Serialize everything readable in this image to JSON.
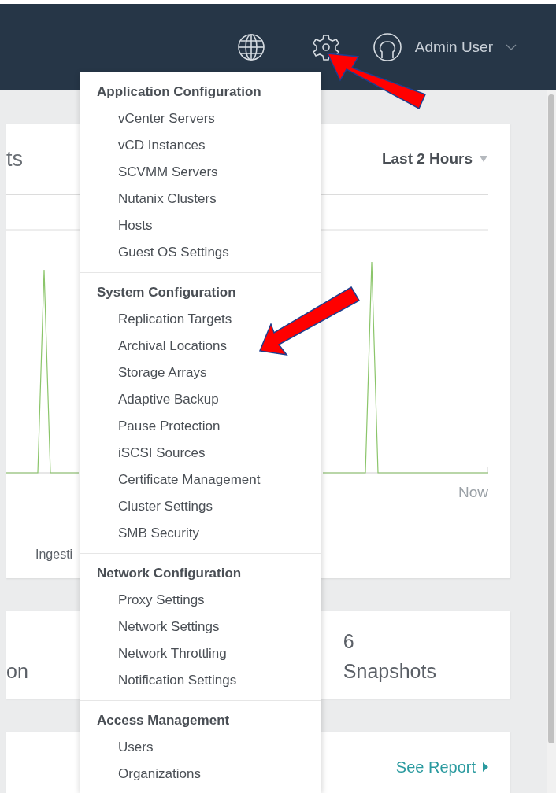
{
  "topbar": {
    "user": "Admin User"
  },
  "settings_menu": {
    "sections": [
      {
        "title": "Application Configuration",
        "items": [
          "vCenter Servers",
          "vCD Instances",
          "SCVMM Servers",
          "Nutanix Clusters",
          "Hosts",
          "Guest OS Settings"
        ]
      },
      {
        "title": "System Configuration",
        "items": [
          "Replication Targets",
          "Archival Locations",
          "Storage Arrays",
          "Adaptive Backup",
          "Pause Protection",
          "iSCSI Sources",
          "Certificate Management",
          "Cluster Settings",
          "SMB Security"
        ]
      },
      {
        "title": "Network Configuration",
        "items": [
          "Proxy Settings",
          "Network Settings",
          "Network Throttling",
          "Notification Settings"
        ]
      },
      {
        "title": "Access Management",
        "items": [
          "Users",
          "Organizations"
        ]
      }
    ]
  },
  "chart_card": {
    "title": "ts",
    "range": "Last 2 Hours",
    "x_end_label": "Now",
    "legend": "Ingesti"
  },
  "stat_card": {
    "left_label": "on",
    "value": "6",
    "label": "Snapshots"
  },
  "report_card": {
    "link": "See Report"
  }
}
